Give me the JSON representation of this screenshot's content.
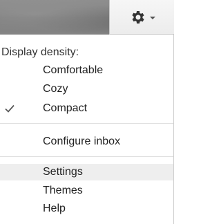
{
  "gear_menu": {
    "button_icon": "gear-icon",
    "dropdown_icon": "chevron-down-icon"
  },
  "menu": {
    "density_heading": "Display density:",
    "density_options": [
      {
        "label": "Comfortable",
        "selected": false
      },
      {
        "label": "Cozy",
        "selected": false
      },
      {
        "label": "Compact",
        "selected": true
      }
    ],
    "check_icon": "check-icon",
    "configure_inbox": "Configure inbox",
    "settings": "Settings",
    "themes": "Themes",
    "help": "Help"
  }
}
